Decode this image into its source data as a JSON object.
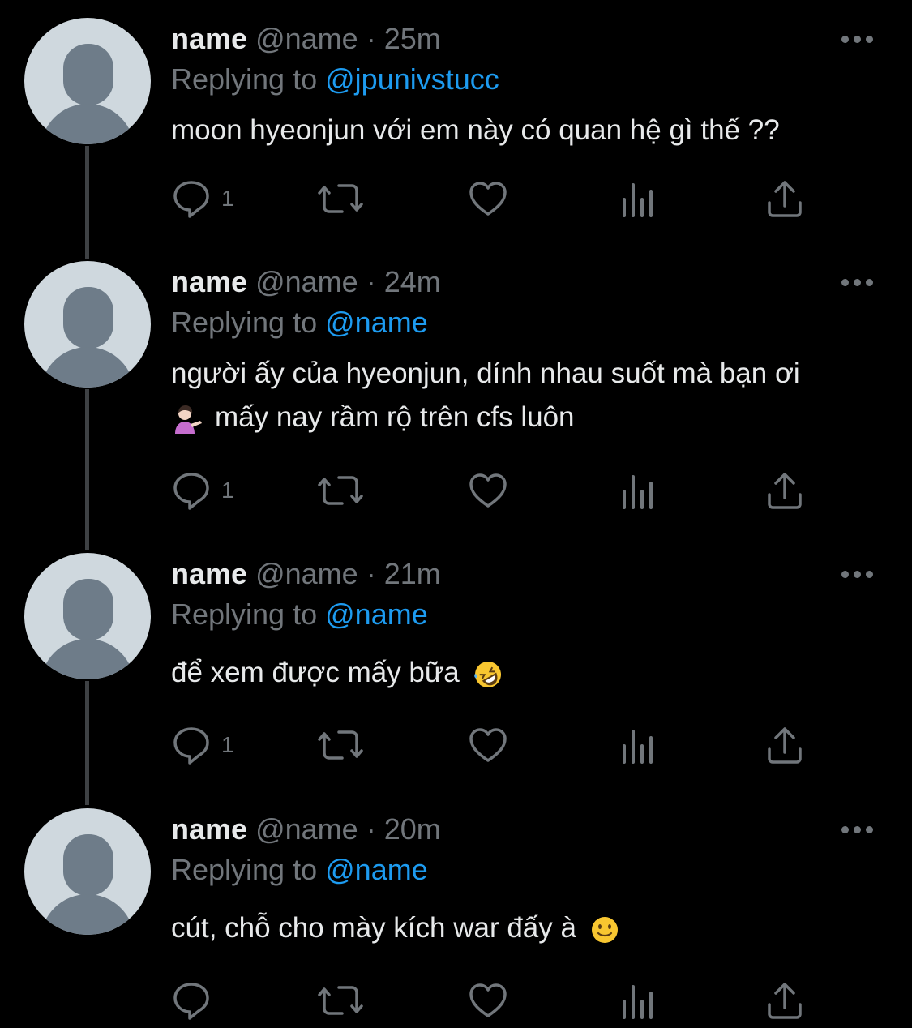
{
  "thread": {
    "tweets": [
      {
        "name": "name",
        "handle": "@name",
        "time": "25m",
        "replying_label": "Replying to",
        "replying_to": "@jpunivstucc",
        "text_lines": [
          "moon hyeonjun với em này có quan hệ gì thế ??"
        ],
        "reply_count": "1"
      },
      {
        "name": "name",
        "handle": "@name",
        "time": "24m",
        "replying_label": "Replying to",
        "replying_to": "@name",
        "text_lines": [
          "người ấy của hyeonjun, dính nhau suốt mà bạn ơi",
          "mấy nay rầm rộ trên cfs luôn"
        ],
        "emoji_before_line2": "person-tipping-hand",
        "reply_count": "1"
      },
      {
        "name": "name",
        "handle": "@name",
        "time": "21m",
        "replying_label": "Replying to",
        "replying_to": "@name",
        "text_lines": [
          "để xem được mấy bữa"
        ],
        "emoji_after_text": "rolling-on-floor-laughing",
        "reply_count": "1"
      },
      {
        "name": "name",
        "handle": "@name",
        "time": "20m",
        "replying_label": "Replying to",
        "replying_to": "@name",
        "text_lines": [
          "cút, chỗ cho mày kích war đấy à"
        ],
        "emoji_after_text": "slightly-smiling-face",
        "reply_count": ""
      }
    ],
    "separator": "·"
  },
  "icons": {
    "reply": "speech-bubble-icon",
    "retweet": "retweet-icon",
    "like": "heart-icon",
    "views": "bar-chart-icon",
    "share": "share-icon",
    "more": "more-dots-icon"
  },
  "colors": {
    "background": "#000000",
    "text": "#e7e9ea",
    "muted": "#71767b",
    "link": "#1d9bf0",
    "avatar_bg": "#cfd8de",
    "avatar_fg": "#6e7c89"
  }
}
